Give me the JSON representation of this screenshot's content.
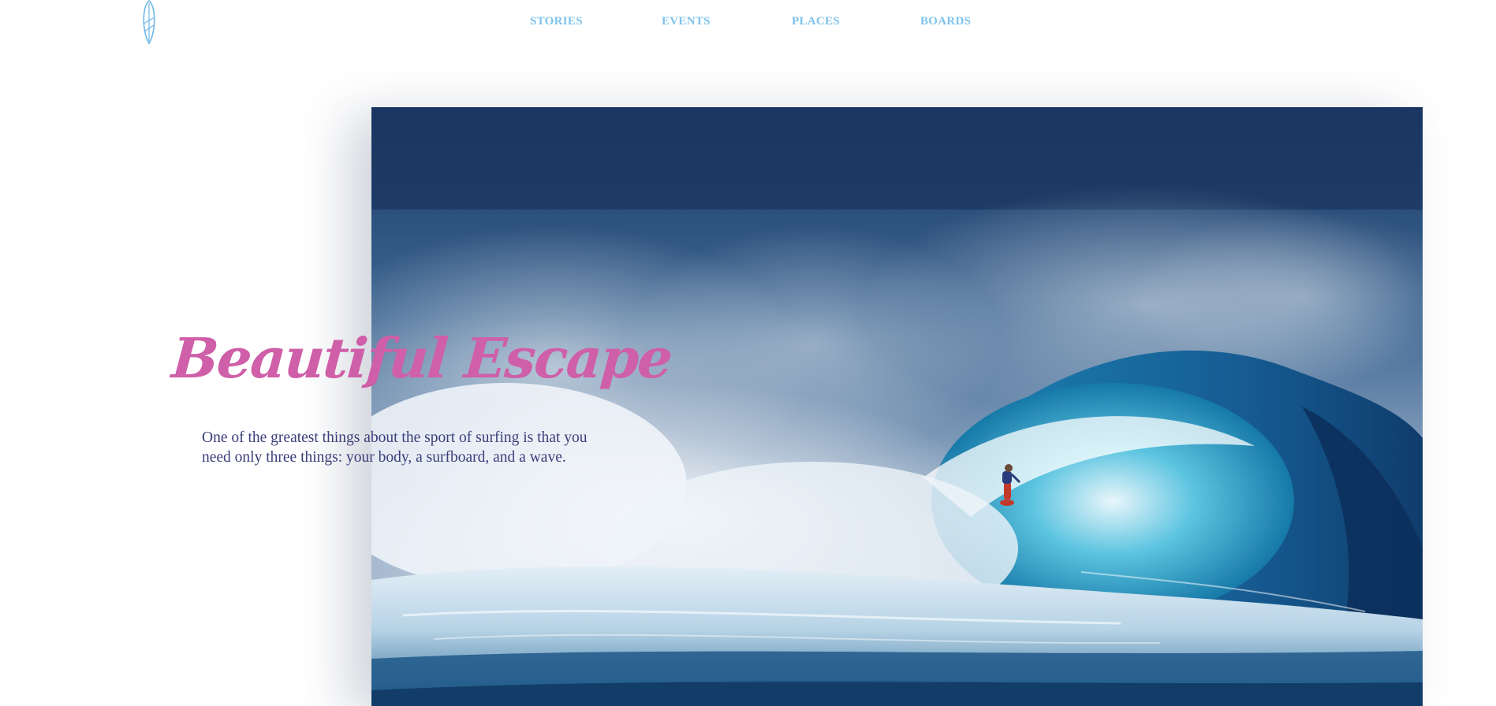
{
  "header": {
    "logo_icon": "surfboard-icon",
    "nav": [
      {
        "label": "STORIES"
      },
      {
        "label": "EVENTS"
      },
      {
        "label": "PLACES"
      },
      {
        "label": "BOARDS"
      }
    ]
  },
  "hero": {
    "title": "Beautiful Escape",
    "description": "One of the greatest things about the sport of surfing is that you need only three things: your body, a surfboard, and a wave.",
    "image_subject": "surfer riding a large breaking ocean wave"
  },
  "colors": {
    "nav": "#7cc3ec",
    "title": "#cf5fa8",
    "body_text": "#3b3f7a",
    "ocean_dark": "#0e2a55",
    "ocean_mid": "#1f6fa6",
    "foam": "#e8f2f8"
  }
}
